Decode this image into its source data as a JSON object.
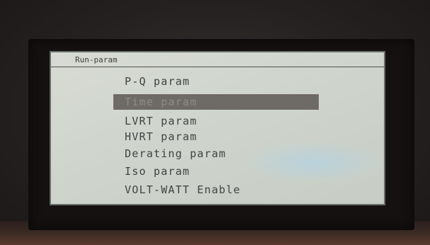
{
  "screen": {
    "header_title": "Run-param",
    "selected_index": 1,
    "menu_items": [
      {
        "label": "P-Q param"
      },
      {
        "label": "Time param"
      },
      {
        "label": "LVRT param"
      },
      {
        "label": "HVRT param"
      },
      {
        "label": "Derating param"
      },
      {
        "label": "Iso param"
      },
      {
        "label": "VOLT-WATT Enable"
      }
    ]
  }
}
